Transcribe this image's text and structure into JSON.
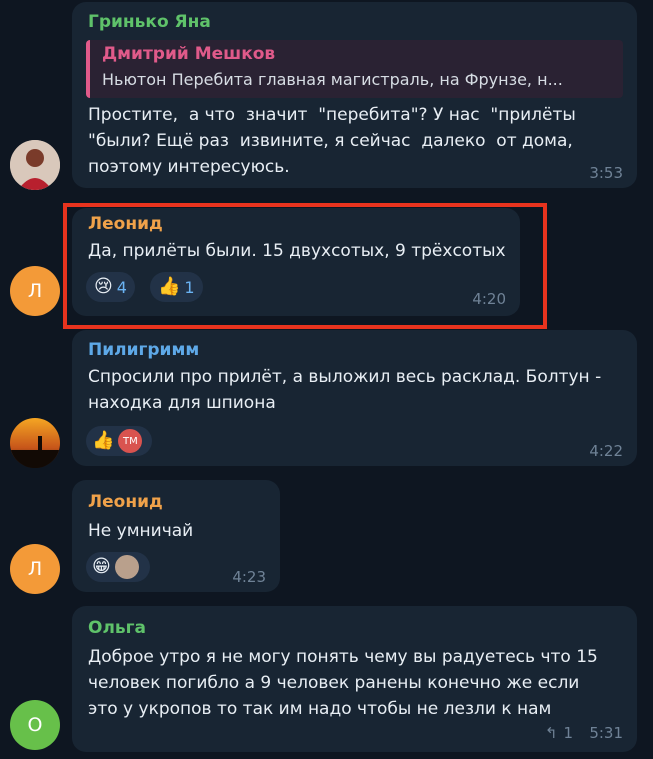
{
  "messages": [
    {
      "sender": "Гринько Яна",
      "sender_color": "#5fc26a",
      "reply": {
        "name": "Дмитрий Мешков",
        "text": "Ньютон Перебита главная магистраль, на Фрунзе, н..."
      },
      "lines": [
        "Простите,  а что  значит  \"перебита\"? У нас  \"прилёты",
        "\"были? Ещё раз  извините, я сейчас  далеко  от дома,",
        "поэтому интересуюсь."
      ],
      "time": "3:53"
    },
    {
      "sender": "Леонид",
      "sender_color": "#f0a24a",
      "avatar_letter": "Л",
      "lines": [
        "Да, прилёты были. 15 двухсотых, 9 трёхсотых"
      ],
      "reactions": [
        {
          "emoji": "😢",
          "count": "4"
        },
        {
          "emoji": "👍",
          "count": "1"
        }
      ],
      "time": "4:20"
    },
    {
      "sender": "Пилигримм",
      "sender_color": "#5ea9e8",
      "lines": [
        "Спросили про прилёт, а выложил весь расклад. Болтун -",
        "находка для шпиона"
      ],
      "reactions": [
        {
          "emoji": "👍",
          "avatar_text": "TM"
        }
      ],
      "time": "4:22"
    },
    {
      "sender": "Леонид",
      "sender_color": "#f0a24a",
      "avatar_letter": "Л",
      "lines": [
        "Не умничай"
      ],
      "reactions": [
        {
          "emoji": "😁"
        }
      ],
      "time": "4:23"
    },
    {
      "sender": "Ольга",
      "sender_color": "#5fc26a",
      "avatar_letter": "О",
      "lines": [
        "Доброе утро я не могу понять чему вы радуетесь что 15",
        "человек погибло а 9 человек ранены конечно же если",
        "это у укропов то так им надо чтобы не лезли к нам"
      ],
      "replies_count": "1",
      "time": "5:31"
    }
  ]
}
